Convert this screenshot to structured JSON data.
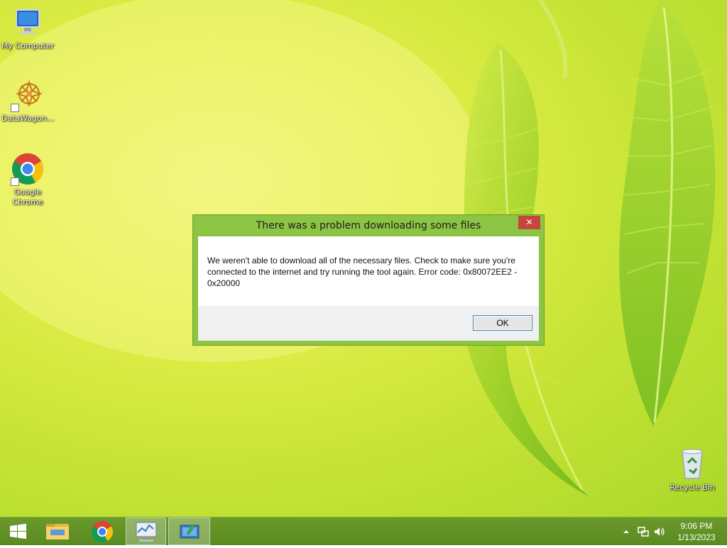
{
  "desktop": {
    "icons": [
      {
        "label": "My Computer",
        "icon": "computer-icon"
      },
      {
        "label": "DataWagon...",
        "icon": "datawagon-icon"
      },
      {
        "label": "Google Chrome",
        "icon": "chrome-icon"
      },
      {
        "label": "Recycle Bin",
        "icon": "recycle-bin-icon"
      }
    ]
  },
  "dialog": {
    "title": "There was a problem downloading some files",
    "close_label": "✕",
    "message": "We weren't able to download all of the necessary files. Check to make sure you're connected to the internet and try running the tool again. Error code: 0x80072EE2 - 0x20000",
    "ok_label": "OK"
  },
  "taskbar": {
    "items": [
      {
        "name": "start",
        "icon": "windows-logo-icon"
      },
      {
        "name": "file-explorer",
        "icon": "folder-icon"
      },
      {
        "name": "chrome",
        "icon": "chrome-icon"
      },
      {
        "name": "performance-monitor",
        "icon": "monitor-chart-icon"
      },
      {
        "name": "media-creation-tool",
        "icon": "media-tool-icon",
        "active": true
      }
    ],
    "tray": {
      "icons": [
        "chevron-up-icon",
        "network-icon",
        "volume-icon"
      ]
    },
    "clock": {
      "time": "9:06 PM",
      "date": "1/13/2023"
    }
  },
  "colors": {
    "dialog_frame": "#8cc443",
    "taskbar": "#5f8e25",
    "close_button": "#c7463b"
  }
}
